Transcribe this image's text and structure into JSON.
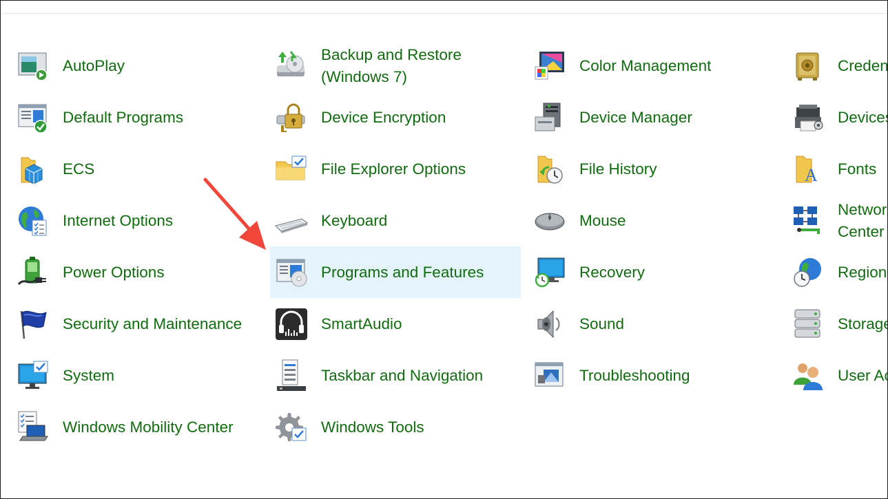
{
  "items": [
    {
      "label": "AutoPlay",
      "icon": "autoplay-icon"
    },
    {
      "label": "Backup and Restore (Windows 7)",
      "icon": "backup-restore-icon"
    },
    {
      "label": "Color Management",
      "icon": "color-management-icon"
    },
    {
      "label": "Credential Manager",
      "icon": "credential-manager-icon"
    },
    {
      "label": "Default Programs",
      "icon": "default-programs-icon"
    },
    {
      "label": "Device Encryption",
      "icon": "device-encryption-icon"
    },
    {
      "label": "Device Manager",
      "icon": "device-manager-icon"
    },
    {
      "label": "Devices and Printers",
      "icon": "devices-printers-icon"
    },
    {
      "label": "ECS",
      "icon": "ecs-icon"
    },
    {
      "label": "File Explorer Options",
      "icon": "file-explorer-options-icon"
    },
    {
      "label": "File History",
      "icon": "file-history-icon"
    },
    {
      "label": "Fonts",
      "icon": "fonts-icon"
    },
    {
      "label": "Internet Options",
      "icon": "internet-options-icon"
    },
    {
      "label": "Keyboard",
      "icon": "keyboard-icon"
    },
    {
      "label": "Mouse",
      "icon": "mouse-icon"
    },
    {
      "label": "Network and Sharing Center",
      "icon": "network-sharing-icon"
    },
    {
      "label": "Power Options",
      "icon": "power-options-icon"
    },
    {
      "label": "Programs and Features",
      "icon": "programs-features-icon"
    },
    {
      "label": "Recovery",
      "icon": "recovery-icon"
    },
    {
      "label": "Region",
      "icon": "region-icon"
    },
    {
      "label": "Security and Maintenance",
      "icon": "security-maintenance-icon"
    },
    {
      "label": "SmartAudio",
      "icon": "smartaudio-icon"
    },
    {
      "label": "Sound",
      "icon": "sound-icon"
    },
    {
      "label": "Storage Spaces",
      "icon": "storage-spaces-icon"
    },
    {
      "label": "System",
      "icon": "system-icon"
    },
    {
      "label": "Taskbar and Navigation",
      "icon": "taskbar-navigation-icon"
    },
    {
      "label": "Troubleshooting",
      "icon": "troubleshooting-icon"
    },
    {
      "label": "User Accounts",
      "icon": "user-accounts-icon"
    },
    {
      "label": "Windows Mobility Center",
      "icon": "windows-mobility-center-icon"
    },
    {
      "label": "Windows Tools",
      "icon": "windows-tools-icon"
    }
  ],
  "highlighted_item": "Programs and Features",
  "colors": {
    "link_text": "#116b0f",
    "highlight_bg": "#e5f3fb",
    "arrow": "#f0473a",
    "divider": "#dfe6ec"
  }
}
